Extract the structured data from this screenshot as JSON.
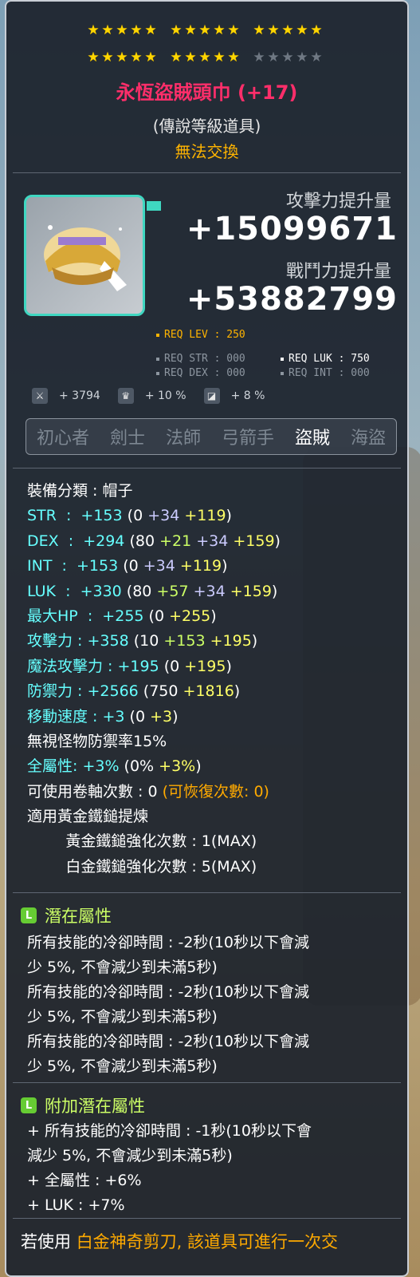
{
  "stars": {
    "row1": [
      5,
      5,
      5
    ],
    "row2_filled": [
      5,
      5,
      0
    ],
    "row2_empty": [
      0,
      0,
      5
    ]
  },
  "item": {
    "name": "永恆盜賊頭巾 (+17)",
    "grade": "(傳說等級道具)",
    "trade": "無法交換",
    "attack_label": "攻擊力提升量",
    "attack_value": "+15099671",
    "power_label": "戰鬥力提升量",
    "power_value": "+53882799",
    "icon": "thief-headband-icon"
  },
  "requirements": {
    "lev": "REQ LEV : 250",
    "str": "REQ STR : 000",
    "luk": "REQ LUK : 750",
    "dex": "REQ DEX : 000",
    "int": "REQ INT : 000"
  },
  "mini_stats": [
    {
      "icon": "sword-icon",
      "value": "+ 3794"
    },
    {
      "icon": "boss-icon",
      "value": "+ 10 %"
    },
    {
      "icon": "shield-icon",
      "value": "+ 8 %"
    }
  ],
  "jobs": {
    "items": [
      "初心者",
      "劍士",
      "法師",
      "弓箭手",
      "盜賊",
      "海盜"
    ],
    "active": "盜賊"
  },
  "stats": [
    {
      "parts": [
        [
          "c-white",
          "裝備分類 : 帽子"
        ]
      ]
    },
    {
      "parts": [
        [
          "c-cyan",
          "STR  :  +153 "
        ],
        [
          "c-white",
          "(0 "
        ],
        [
          "c-purple",
          "+34 "
        ],
        [
          "c-yellow",
          "+119"
        ],
        [
          "c-white",
          ")"
        ]
      ]
    },
    {
      "parts": [
        [
          "c-cyan",
          "DEX  :  +294 "
        ],
        [
          "c-white",
          "(80 "
        ],
        [
          "c-green",
          "+21 "
        ],
        [
          "c-purple",
          "+34 "
        ],
        [
          "c-yellow",
          "+159"
        ],
        [
          "c-white",
          ")"
        ]
      ]
    },
    {
      "parts": [
        [
          "c-cyan",
          "INT  :  +153 "
        ],
        [
          "c-white",
          "(0 "
        ],
        [
          "c-purple",
          "+34 "
        ],
        [
          "c-yellow",
          "+119"
        ],
        [
          "c-white",
          ")"
        ]
      ]
    },
    {
      "parts": [
        [
          "c-cyan",
          "LUK  :  +330 "
        ],
        [
          "c-white",
          "(80 "
        ],
        [
          "c-green",
          "+57 "
        ],
        [
          "c-purple",
          "+34 "
        ],
        [
          "c-yellow",
          "+159"
        ],
        [
          "c-white",
          ")"
        ]
      ]
    },
    {
      "parts": [
        [
          "c-cyan",
          "最大HP  :  +255 "
        ],
        [
          "c-white",
          "(0 "
        ],
        [
          "c-yellow",
          "+255"
        ],
        [
          "c-white",
          ")"
        ]
      ]
    },
    {
      "parts": [
        [
          "c-cyan",
          "攻擊力 : +358 "
        ],
        [
          "c-white",
          "(10 "
        ],
        [
          "c-green",
          "+153 "
        ],
        [
          "c-yellow",
          "+195"
        ],
        [
          "c-white",
          ")"
        ]
      ]
    },
    {
      "parts": [
        [
          "c-cyan",
          "魔法攻擊力 : +195 "
        ],
        [
          "c-white",
          "(0 "
        ],
        [
          "c-yellow",
          "+195"
        ],
        [
          "c-white",
          ")"
        ]
      ]
    },
    {
      "parts": [
        [
          "c-cyan",
          "防禦力 : +2566 "
        ],
        [
          "c-white",
          "(750 "
        ],
        [
          "c-yellow",
          "+1816"
        ],
        [
          "c-white",
          ")"
        ]
      ]
    },
    {
      "parts": [
        [
          "c-cyan",
          "移動速度 : +3 "
        ],
        [
          "c-white",
          "(0 "
        ],
        [
          "c-yellow",
          "+3"
        ],
        [
          "c-white",
          ")"
        ]
      ]
    },
    {
      "parts": [
        [
          "c-white",
          "無視怪物防禦率15%"
        ]
      ]
    },
    {
      "parts": [
        [
          "c-cyan",
          "全屬性: +3% "
        ],
        [
          "c-white",
          "(0% "
        ],
        [
          "c-yellow",
          "+3%"
        ],
        [
          "c-white",
          ")"
        ]
      ]
    },
    {
      "parts": [
        [
          "c-white",
          "可使用卷軸次數 : 0 "
        ],
        [
          "c-orange",
          "(可恢復次數: 0)"
        ]
      ]
    },
    {
      "parts": [
        [
          "c-white",
          "適用黃金鐵鎚提煉"
        ]
      ]
    },
    {
      "parts": [
        [
          "c-white",
          "        黃金鐵鎚強化次數 : 1(MAX)"
        ]
      ]
    },
    {
      "parts": [
        [
          "c-white",
          "        白金鐵鎚強化次數 : 5(MAX)"
        ]
      ]
    }
  ],
  "potential": {
    "badge": "L",
    "title": "潛在屬性",
    "lines": [
      "所有技能的冷卻時間 : -2秒(10秒以下會減",
      "少 5%, 不會減少到未滿5秒)",
      "所有技能的冷卻時間 : -2秒(10秒以下會減",
      "少 5%, 不會減少到未滿5秒)",
      "所有技能的冷卻時間 : -2秒(10秒以下會減",
      "少 5%, 不會減少到未滿5秒)"
    ]
  },
  "additional_potential": {
    "badge": "L",
    "title": "附加潛在屬性",
    "lines": [
      "+ 所有技能的冷卻時間 : -1秒(10秒以下會",
      "減少 5%, 不會減少到未滿5秒)",
      "+ 全屬性 : +6%",
      "+ LUK : +7%"
    ]
  },
  "footer": {
    "prefix": "若使用 ",
    "highlight": "白金神奇剪刀, 該道具可進行一次交"
  }
}
